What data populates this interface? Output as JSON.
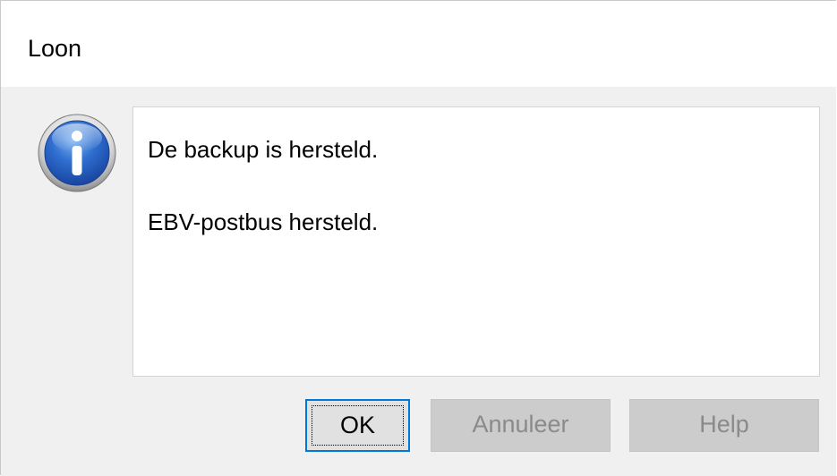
{
  "window": {
    "title": "Loon"
  },
  "message": {
    "icon": "information-icon",
    "line1": "De backup is hersteld.",
    "line2": "EBV-postbus hersteld."
  },
  "buttons": {
    "ok_label": "OK",
    "cancel_label": "Annuleer",
    "help_label": "Help"
  },
  "colors": {
    "focus_border": "#0078d7",
    "dialog_background": "#f0f0f0",
    "disabled_text": "#8a8a8a"
  }
}
